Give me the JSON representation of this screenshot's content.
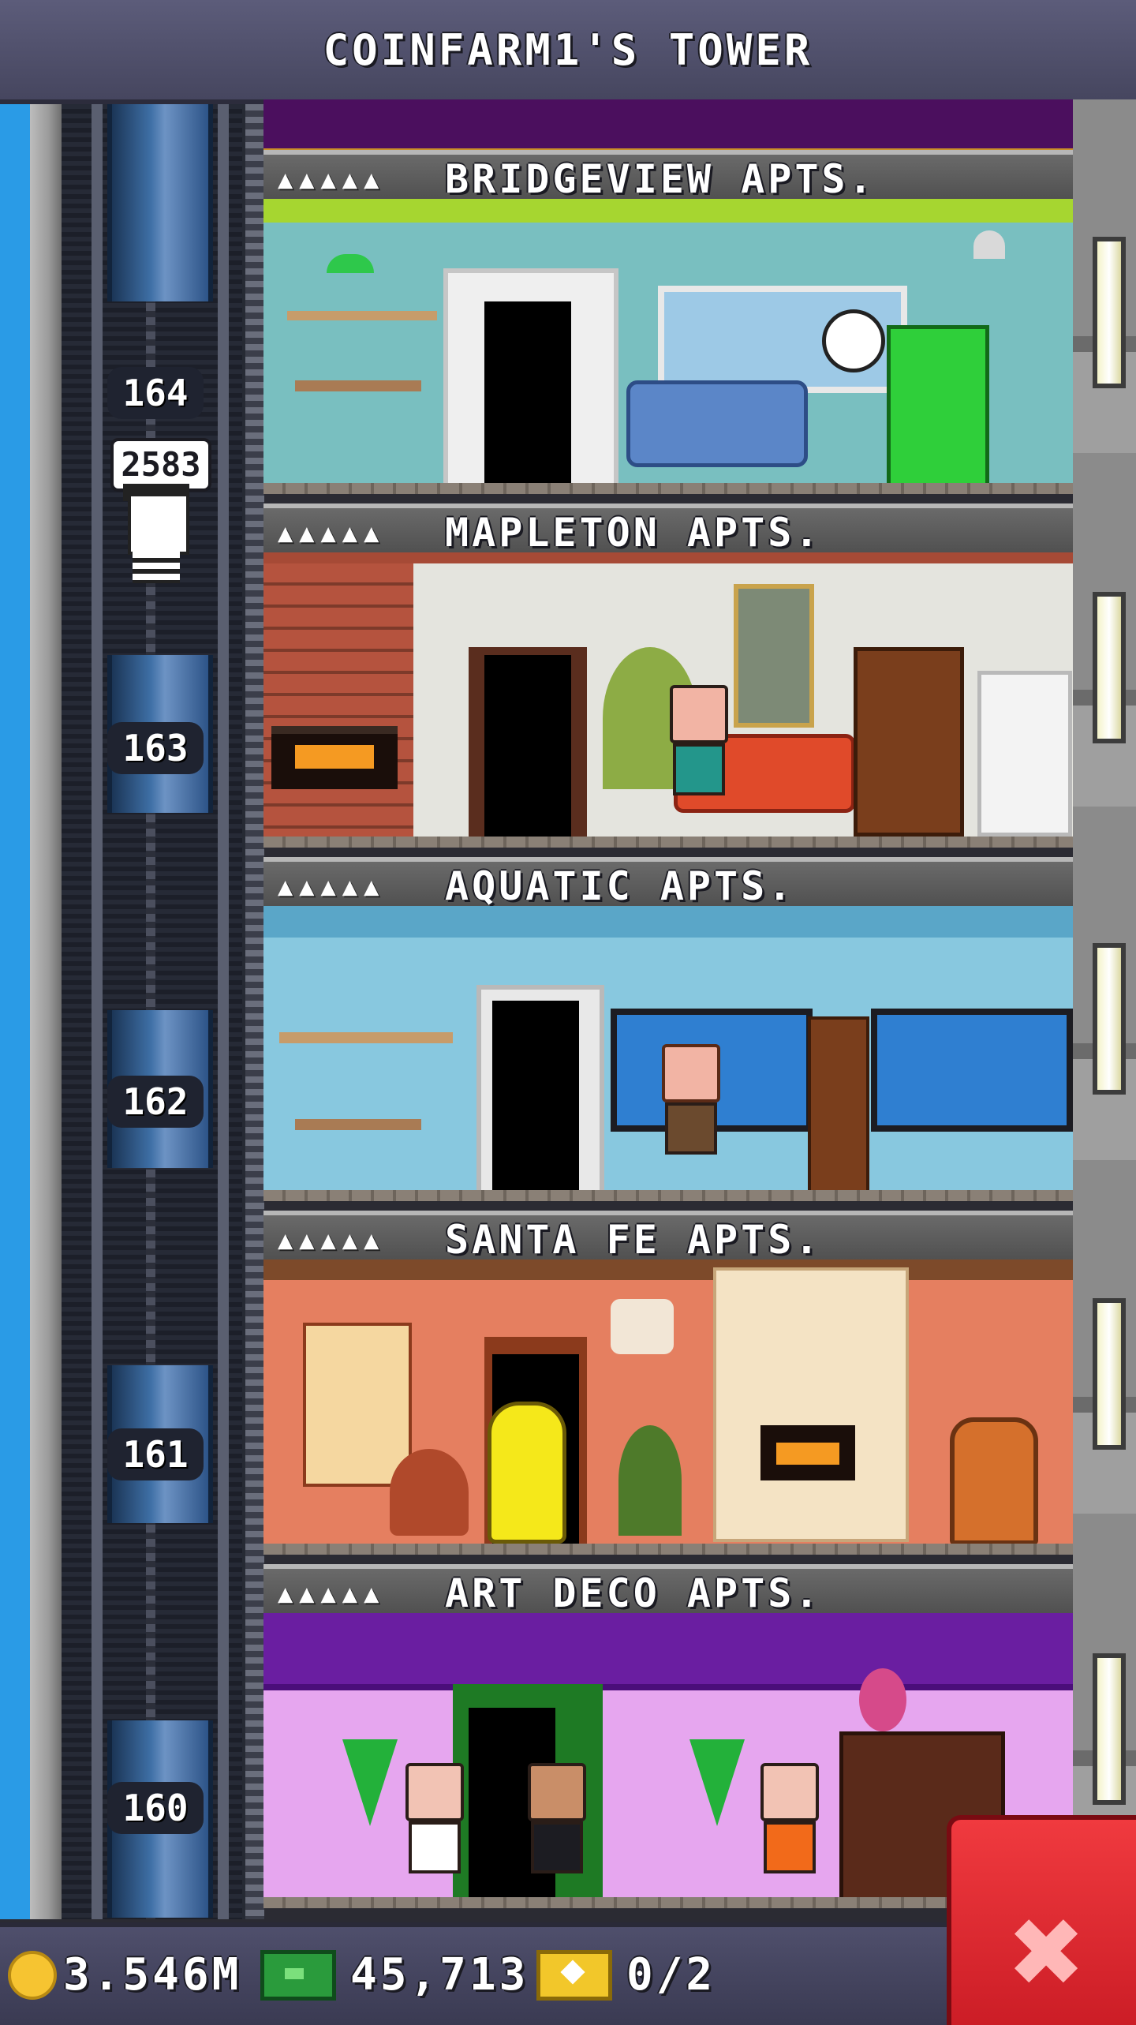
{
  "header": {
    "title": "COINFARM1'S TOWER"
  },
  "elevator": {
    "floor_numbers": [
      "164",
      "163",
      "162",
      "161",
      "160"
    ],
    "passenger_bubble": "2583"
  },
  "floors": [
    {
      "stars": "▲▲▲▲▲",
      "name": "BRIDGEVIEW APTS.",
      "wall_color": "#79bfc0",
      "accent": "#a6d630"
    },
    {
      "stars": "▲▲▲▲▲",
      "name": "MAPLETON APTS.",
      "wall_color": "#e4e4de",
      "accent": "#a64a36"
    },
    {
      "stars": "▲▲▲▲▲",
      "name": "AQUATIC APTS.",
      "wall_color": "#88c8df",
      "accent": "#5aa6c8"
    },
    {
      "stars": "▲▲▲▲▲",
      "name": "SANTA FE APTS.",
      "wall_color": "#e57f60",
      "accent": "#f4e3c4"
    },
    {
      "stars": "▲▲▲▲▲",
      "name": "ART DECO APTS.",
      "wall_color": "#e6a6ef",
      "accent": "#6a1ea1"
    }
  ],
  "status_bar": {
    "coins": "3.546M",
    "bux": "45,713",
    "tickets": "0/2"
  },
  "icons": {
    "coin": "coin-icon",
    "bux": "bux-icon",
    "ticket": "ticket-icon",
    "close": "close-icon"
  }
}
